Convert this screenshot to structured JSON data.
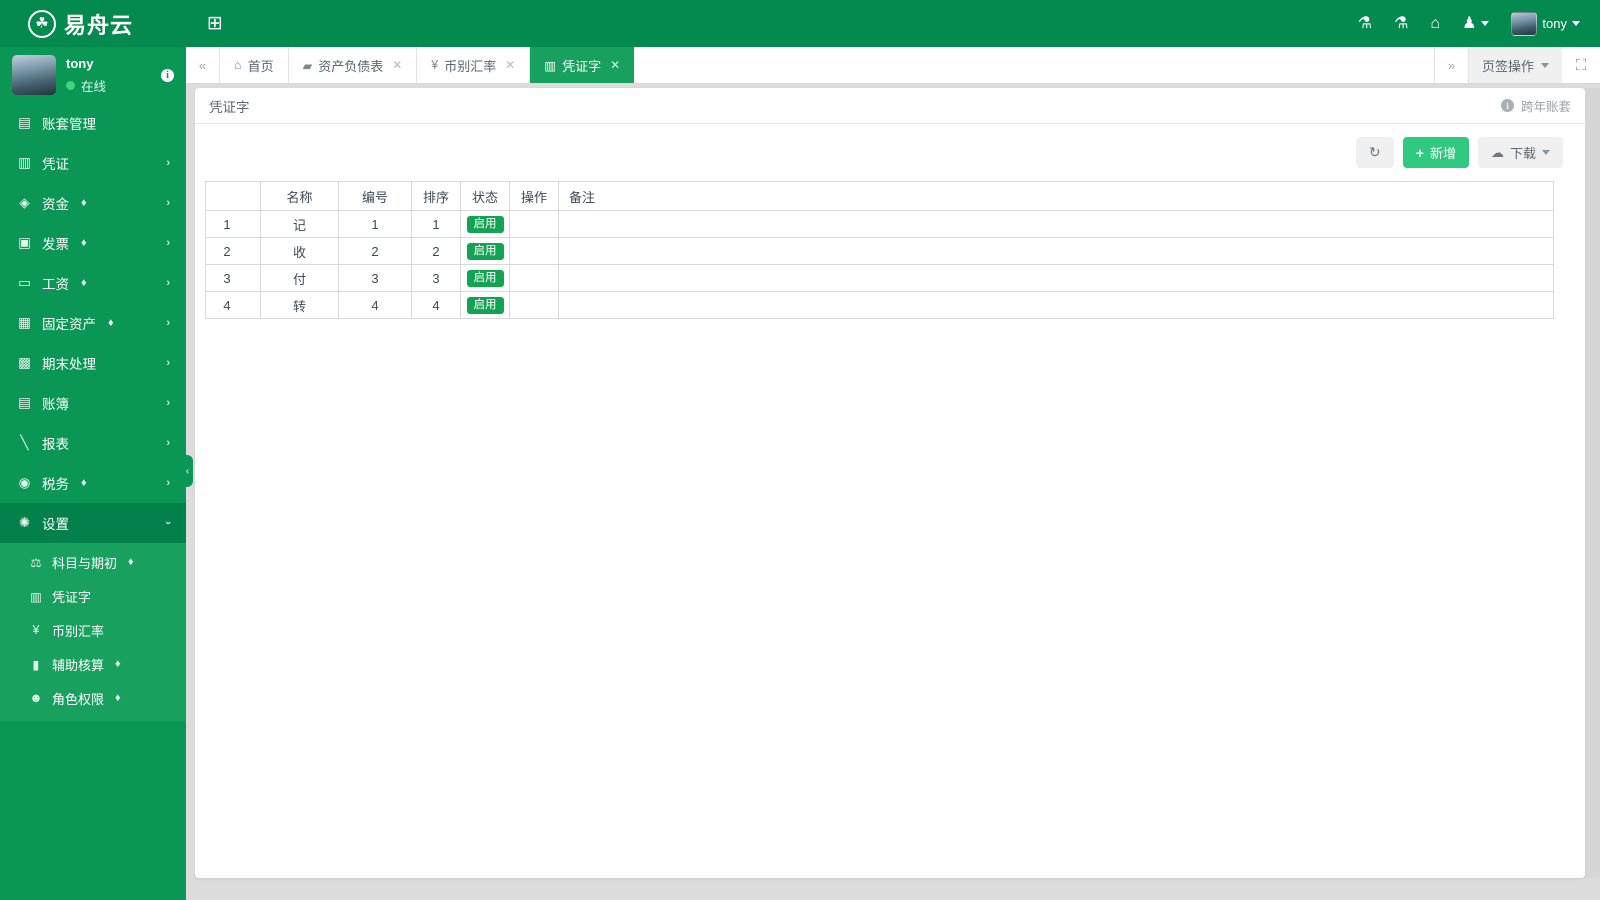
{
  "header": {
    "brand_logo_icon": "leaf-logo-icon",
    "brand_name": "易舟云",
    "grid_icon": "grid-add-icon",
    "right_icons": [
      {
        "name": "bug-icon-1",
        "glyph": "⚗"
      },
      {
        "name": "bug-icon-2",
        "glyph": "⚗"
      },
      {
        "name": "home-icon",
        "glyph": "⌂"
      },
      {
        "name": "user-switch-icon",
        "glyph": "♟"
      }
    ],
    "username": "tony"
  },
  "sidebar": {
    "user": {
      "name": "tony",
      "status": "在线",
      "info_badge": "i"
    },
    "items": [
      {
        "label": "账套管理",
        "icon": "book-icon",
        "glyph": "▤",
        "arrow": false,
        "vip": false
      },
      {
        "label": "凭证",
        "icon": "voucher-icon",
        "glyph": "▥",
        "arrow": true,
        "vip": false
      },
      {
        "label": "资金",
        "icon": "funds-icon",
        "glyph": "◈",
        "arrow": true,
        "vip": true
      },
      {
        "label": "发票",
        "icon": "invoice-icon",
        "glyph": "▣",
        "arrow": true,
        "vip": true
      },
      {
        "label": "工资",
        "icon": "payroll-card-icon",
        "glyph": "▭",
        "arrow": true,
        "vip": true
      },
      {
        "label": "固定资产",
        "icon": "building-icon",
        "glyph": "▦",
        "arrow": true,
        "vip": true
      },
      {
        "label": "期末处理",
        "icon": "calendar-icon",
        "glyph": "▩",
        "arrow": true,
        "vip": false
      },
      {
        "label": "账簿",
        "icon": "ledger-icon",
        "glyph": "▤",
        "arrow": true,
        "vip": false
      },
      {
        "label": "报表",
        "icon": "chart-line-icon",
        "glyph": "📈",
        "arrow": true,
        "vip": false
      },
      {
        "label": "税务",
        "icon": "tax-icon",
        "glyph": "◉",
        "arrow": true,
        "vip": true
      }
    ],
    "settings": {
      "label": "设置",
      "icon": "gear-icon",
      "glyph": "✿",
      "expanded": true,
      "children": [
        {
          "label": "科目与期初",
          "icon": "subject-icon",
          "glyph": "⚗",
          "vip": true,
          "active": false
        },
        {
          "label": "凭证字",
          "icon": "voucher-word-icon",
          "glyph": "▥",
          "vip": false,
          "active": true
        },
        {
          "label": "币别汇率",
          "icon": "yen-icon",
          "glyph": "¥",
          "vip": false,
          "active": false
        },
        {
          "label": "辅助核算",
          "icon": "folder-icon",
          "glyph": "▰",
          "vip": true,
          "active": false
        },
        {
          "label": "角色权限",
          "icon": "users-icon",
          "glyph": "👥",
          "vip": true,
          "active": false
        }
      ]
    },
    "collapse_handle_icon": "chevron-left-icon"
  },
  "tabs": {
    "prev_icon": "double-chevron-left-icon",
    "next_icon": "double-chevron-right-icon",
    "items": [
      {
        "label": "首页",
        "icon": "home-icon",
        "glyph": "⌂",
        "closable": false,
        "active": false
      },
      {
        "label": "资产负债表",
        "icon": "chart-icon",
        "glyph": "▰",
        "closable": true,
        "active": false
      },
      {
        "label": "币别汇率",
        "icon": "yen-icon",
        "glyph": "¥",
        "closable": true,
        "active": false
      },
      {
        "label": "凭证字",
        "icon": "voucher-icon",
        "glyph": "▥",
        "closable": true,
        "active": true
      }
    ],
    "ops_label": "页签操作",
    "expand_icon": "fullscreen-icon"
  },
  "panel": {
    "title": "凭证字",
    "cross_year_label": "跨年账套",
    "cross_year_info_icon": "info-icon"
  },
  "toolbar": {
    "refresh_label": "",
    "refresh_icon": "refresh-icon",
    "add_label": "新增",
    "add_icon": "plus-icon",
    "download_label": "下载",
    "download_icon": "cloud-download-icon"
  },
  "table": {
    "columns": [
      "",
      "名称",
      "编号",
      "排序",
      "状态",
      "操作",
      "备注"
    ],
    "rows": [
      {
        "index": "1",
        "name": "记",
        "code": "1",
        "sort": "1",
        "status": "启用",
        "action": "",
        "note": ""
      },
      {
        "index": "2",
        "name": "收",
        "code": "2",
        "sort": "2",
        "status": "启用",
        "action": "",
        "note": ""
      },
      {
        "index": "3",
        "name": "付",
        "code": "3",
        "sort": "3",
        "status": "启用",
        "action": "",
        "note": ""
      },
      {
        "index": "4",
        "name": "转",
        "code": "4",
        "sort": "4",
        "status": "启用",
        "action": "",
        "note": ""
      }
    ]
  },
  "colors": {
    "header_green": "#048a4f",
    "sidebar_green": "#0a9755",
    "submenu_green": "#18a05f",
    "active_nav_green": "#02814a",
    "primary_button": "#2fca7f",
    "badge_green": "#13a453",
    "page_bg": "#dcdcdc"
  }
}
